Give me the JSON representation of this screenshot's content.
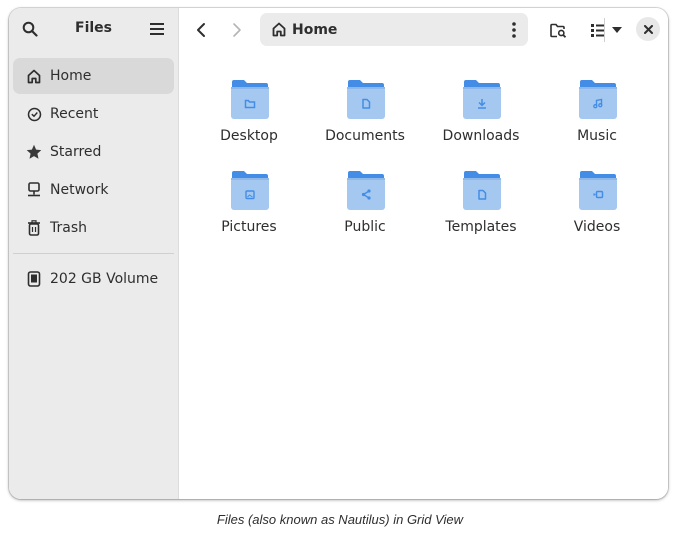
{
  "window": {
    "title": "Files",
    "caption": "Files (also known as Nautilus) in Grid View"
  },
  "sidebar": {
    "header": {
      "title": "Files",
      "search_icon": "search-icon",
      "menu_icon": "hamburger-menu-icon"
    },
    "items": [
      {
        "label": "Home",
        "icon": "home-icon",
        "active": true
      },
      {
        "label": "Recent",
        "icon": "clock-icon",
        "active": false
      },
      {
        "label": "Starred",
        "icon": "star-icon",
        "active": false
      },
      {
        "label": "Network",
        "icon": "network-icon",
        "active": false
      },
      {
        "label": "Trash",
        "icon": "trash-icon",
        "active": false
      }
    ],
    "devices": [
      {
        "label": "202 GB Volume",
        "icon": "drive-icon"
      }
    ]
  },
  "toolbar": {
    "back_icon": "chevron-left-icon",
    "forward_icon": "chevron-right-icon",
    "path": {
      "label": "Home",
      "icon": "home-icon",
      "menu_icon": "vertical-dots-icon"
    },
    "search_folder_icon": "folder-search-icon",
    "view_icon": "list-view-icon",
    "view_dropdown_icon": "dropdown-arrow-icon",
    "close_icon": "close-icon"
  },
  "colors": {
    "folder_front": "#a4c8f0",
    "folder_back": "#438de6",
    "folder_emblem": "#438de6",
    "sidebar_bg": "#ebebeb",
    "sidebar_active": "#d9d9d9"
  },
  "files": [
    {
      "name": "Desktop",
      "emblem": "folder-emblem"
    },
    {
      "name": "Documents",
      "emblem": "document-emblem"
    },
    {
      "name": "Downloads",
      "emblem": "download-emblem"
    },
    {
      "name": "Music",
      "emblem": "music-emblem"
    },
    {
      "name": "Pictures",
      "emblem": "picture-emblem"
    },
    {
      "name": "Public",
      "emblem": "share-emblem"
    },
    {
      "name": "Templates",
      "emblem": "template-emblem"
    },
    {
      "name": "Videos",
      "emblem": "video-emblem"
    }
  ]
}
